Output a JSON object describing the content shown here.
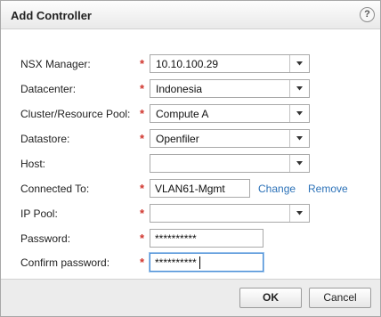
{
  "dialog": {
    "title": "Add Controller",
    "help_label": "?"
  },
  "required_marker": "*",
  "form": {
    "nsx_manager": {
      "label": "NSX Manager:",
      "value": "10.10.100.29"
    },
    "datacenter": {
      "label": "Datacenter:",
      "value": "Indonesia"
    },
    "cluster_resource_pool": {
      "label": "Cluster/Resource Pool:",
      "value": "Compute A"
    },
    "datastore": {
      "label": "Datastore:",
      "value": "Openfiler"
    },
    "host": {
      "label": "Host:",
      "value": ""
    },
    "connected_to": {
      "label": "Connected To:",
      "value": "VLAN61-Mgmt",
      "change_label": "Change",
      "remove_label": "Remove"
    },
    "ip_pool": {
      "label": "IP Pool:",
      "value": ""
    },
    "password": {
      "label": "Password:",
      "value": "**********"
    },
    "confirm_password": {
      "label": "Confirm password:",
      "value": "**********"
    }
  },
  "footer": {
    "ok_label": "OK",
    "cancel_label": "Cancel"
  },
  "icons": {
    "dropdown": "chevron-down-icon",
    "help": "help-icon"
  },
  "colors": {
    "required": "#d0342c",
    "link": "#2c72b8",
    "focus": "#4b8fd6"
  }
}
